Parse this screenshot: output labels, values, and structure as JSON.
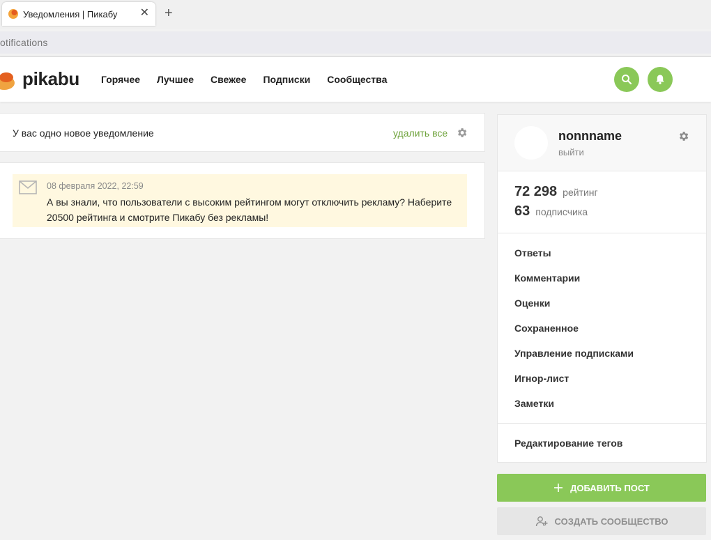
{
  "browser": {
    "tab_title": "Уведомления | Пикабу",
    "tab_close": "✕",
    "new_tab": "+",
    "address": "otifications"
  },
  "header": {
    "logo_text": "pikabu",
    "nav": [
      "Горячее",
      "Лучшее",
      "Свежее",
      "Подписки",
      "Сообщества"
    ],
    "accent_color": "#8ac858"
  },
  "notifications": {
    "count_text": "У вас одно новое уведомление",
    "delete_all": "удалить все",
    "items": [
      {
        "date": "08 февраля 2022, 22:59",
        "text": "А вы знали, что пользователи с высоким рейтингом могут отключить рекламу? Наберите 20500 рейтинга и смотрите Пикабу без рекламы!"
      }
    ]
  },
  "profile": {
    "username": "nonnname",
    "logout": "выйти",
    "rating_value": "72 298",
    "rating_label": "рейтинг",
    "subs_value": "63",
    "subs_label": "подписчика",
    "menu": [
      "Ответы",
      "Комментарии",
      "Оценки",
      "Сохраненное",
      "Управление подписками",
      "Игнор-лист",
      "Заметки"
    ],
    "edit_tags": "Редактирование тегов"
  },
  "actions": {
    "add_post": "ДОБАВИТЬ ПОСТ",
    "create_community": "СОЗДАТЬ СООБЩЕСТВО"
  }
}
